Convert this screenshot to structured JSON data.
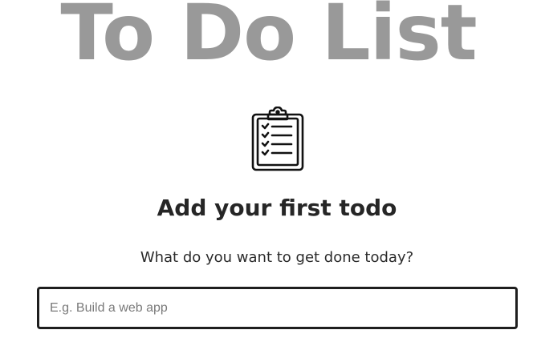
{
  "header": {
    "title": "To Do List"
  },
  "empty_state": {
    "icon": "clipboard-checklist-icon",
    "heading": "Add your first todo",
    "subtitle": "What do you want to get done today?"
  },
  "new_todo": {
    "value": "",
    "placeholder": "E.g. Build a web app"
  },
  "colors": {
    "title": "#999999",
    "heading": "#262626",
    "input_border": "#1e1e1e"
  }
}
